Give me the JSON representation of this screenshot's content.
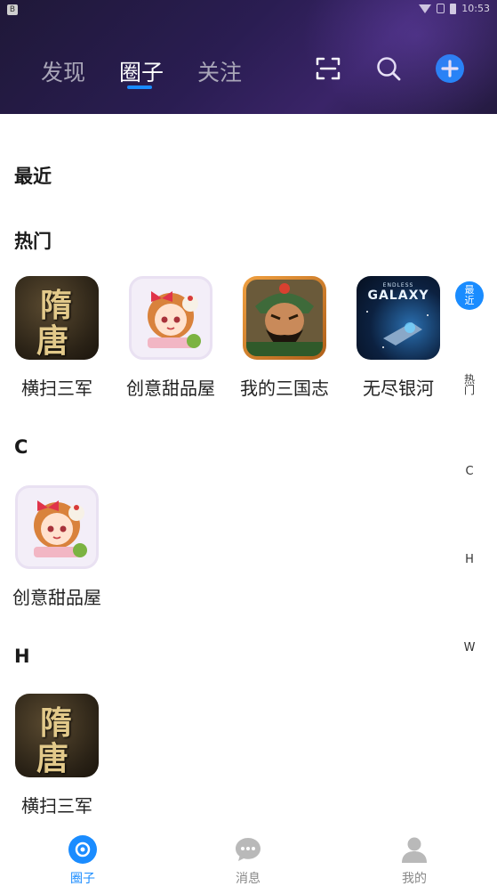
{
  "status_bar": {
    "time": "10:53"
  },
  "header": {
    "tabs": [
      {
        "label": "发现",
        "active": false
      },
      {
        "label": "圈子",
        "active": true
      },
      {
        "label": "关注",
        "active": false
      }
    ],
    "icons": [
      "scan-icon",
      "search-icon",
      "add-icon"
    ]
  },
  "sections": {
    "recent": {
      "title": "最近"
    },
    "hot": {
      "title": "热门",
      "apps": [
        {
          "name": "横扫三军",
          "icon": "suitang-game-icon"
        },
        {
          "name": "创意甜品屋",
          "icon": "dessert-game-icon"
        },
        {
          "name": "我的三国志",
          "icon": "sanguo-game-icon"
        },
        {
          "name": "无尽银河",
          "icon": "galaxy-game-icon"
        }
      ]
    },
    "c": {
      "title": "C",
      "apps": [
        {
          "name": "创意甜品屋",
          "icon": "dessert-game-icon"
        }
      ]
    },
    "h": {
      "title": "H",
      "apps": [
        {
          "name": "横扫三军",
          "icon": "suitang-game-icon"
        }
      ]
    }
  },
  "icon_text": {
    "suitang_top": "隋",
    "suitang_bottom": "唐",
    "galaxy_small": "ENDLESS",
    "galaxy_big": "GALAXY"
  },
  "side_index": {
    "active": "最近",
    "items": [
      "热门",
      "C",
      "H",
      "W"
    ]
  },
  "bottom_nav": [
    {
      "label": "圈子",
      "active": true,
      "icon": "circle-target-icon"
    },
    {
      "label": "消息",
      "active": false,
      "icon": "chat-bubble-icon"
    },
    {
      "label": "我的",
      "active": false,
      "icon": "person-icon"
    }
  ],
  "colors": {
    "accent": "#1a8cff",
    "header_bg": "#2a1d52"
  }
}
